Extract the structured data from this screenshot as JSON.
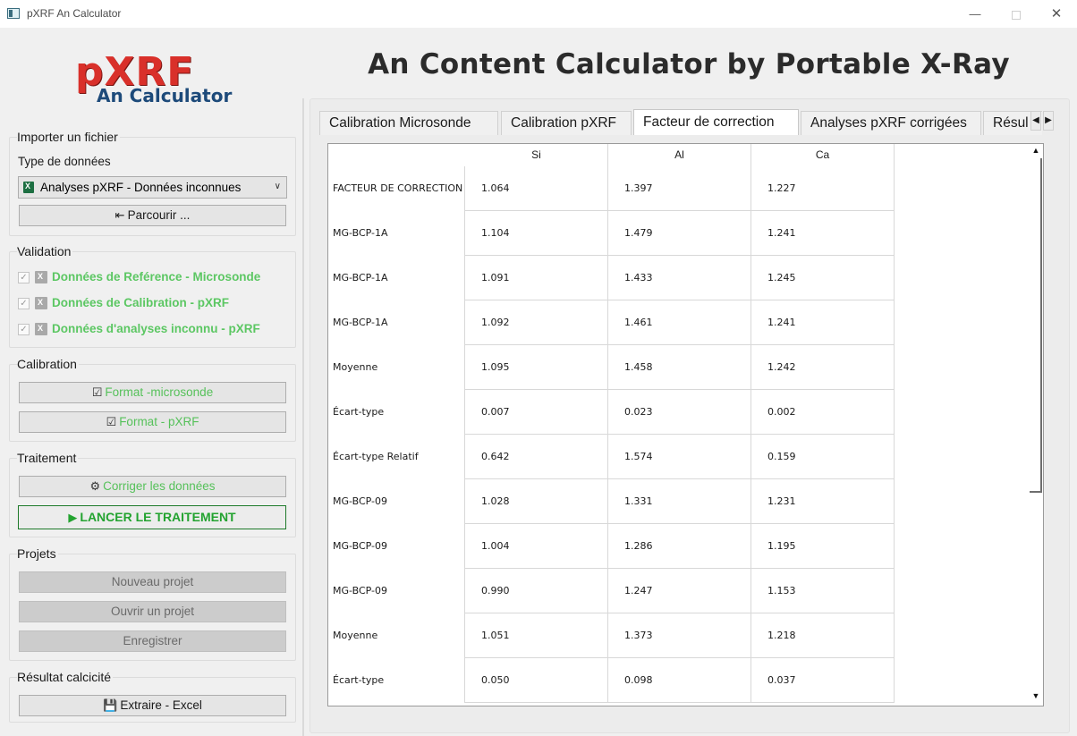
{
  "window": {
    "title": "pXRF An Calculator",
    "minimize": "—",
    "close": "✕"
  },
  "logo": {
    "line1": "pXRF",
    "line2": "An Calculator"
  },
  "header": {
    "title": "An Content Calculator by Portable X-Ray"
  },
  "import": {
    "group_title": "Importer un fichier",
    "type_label": "Type de données",
    "type_value": "Analyses pXRF - Données inconnues",
    "browse_label": "Parcourir ..."
  },
  "validation": {
    "group_title": "Validation",
    "items": [
      {
        "label": "Données de Reférence - Microsonde"
      },
      {
        "label": "Données de Calibration - pXRF"
      },
      {
        "label": "Données d'analyses inconnu - pXRF"
      }
    ]
  },
  "calibration": {
    "group_title": "Calibration",
    "format_micro": "Format -microsonde",
    "format_pxrf": "Format - pXRF"
  },
  "traitement": {
    "group_title": "Traitement",
    "correct_label": "Corriger les données",
    "launch_label": "LANCER LE TRAITEMENT"
  },
  "projets": {
    "group_title": "Projets",
    "new_label": "Nouveau projet",
    "open_label": "Ouvrir un projet",
    "save_label": "Enregistrer"
  },
  "resultat": {
    "group_title": "Résultat calcicité",
    "export_label": "Extraire - Excel"
  },
  "tabs": [
    {
      "label": "Calibration Microsonde",
      "active": false
    },
    {
      "label": "Calibration pXRF",
      "active": false
    },
    {
      "label": "Facteur de correction",
      "active": true
    },
    {
      "label": "Analyses pXRF corrigées",
      "active": false
    },
    {
      "label": "Résul",
      "active": false
    }
  ],
  "table": {
    "columns": [
      "Si",
      "Al",
      "Ca"
    ],
    "rows": [
      {
        "label": "FACTEUR DE CORRECTION",
        "values": [
          "1.064",
          "1.397",
          "1.227"
        ]
      },
      {
        "label": "MG-BCP-1A",
        "values": [
          "1.104",
          "1.479",
          "1.241"
        ]
      },
      {
        "label": "MG-BCP-1A",
        "values": [
          "1.091",
          "1.433",
          "1.245"
        ]
      },
      {
        "label": "MG-BCP-1A",
        "values": [
          "1.092",
          "1.461",
          "1.241"
        ]
      },
      {
        "label": "Moyenne",
        "values": [
          "1.095",
          "1.458",
          "1.242"
        ]
      },
      {
        "label": "Écart-type",
        "values": [
          "0.007",
          "0.023",
          "0.002"
        ]
      },
      {
        "label": "Écart-type Relatif",
        "values": [
          "0.642",
          "1.574",
          "0.159"
        ]
      },
      {
        "label": "MG-BCP-09",
        "values": [
          "1.028",
          "1.331",
          "1.231"
        ]
      },
      {
        "label": "MG-BCP-09",
        "values": [
          "1.004",
          "1.286",
          "1.195"
        ]
      },
      {
        "label": "MG-BCP-09",
        "values": [
          "0.990",
          "1.247",
          "1.153"
        ]
      },
      {
        "label": "Moyenne",
        "values": [
          "1.051",
          "1.373",
          "1.218"
        ]
      },
      {
        "label": "Écart-type",
        "values": [
          "0.050",
          "0.098",
          "0.037"
        ]
      }
    ]
  },
  "colors": {
    "accent_green": "#5cc763",
    "launch_green": "#23a330",
    "logo_red": "#d9302a",
    "logo_blue": "#1d4a7a"
  }
}
